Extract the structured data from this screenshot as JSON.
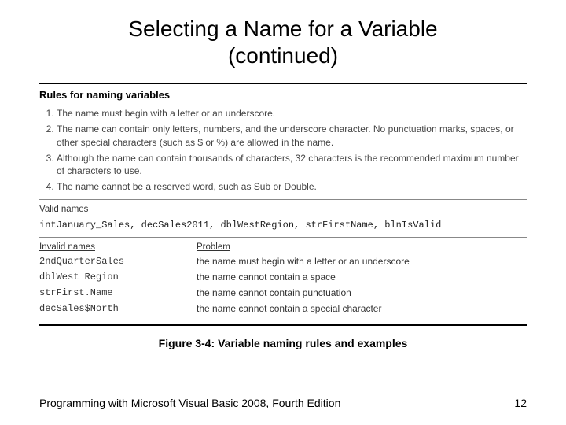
{
  "title_line1": "Selecting a Name for a Variable",
  "title_line2": "(continued)",
  "rules_heading": "Rules for naming variables",
  "rules": [
    "The name must begin with a letter or an underscore.",
    "The name can contain only letters, numbers, and the underscore character. No punctuation marks, spaces, or other special characters (such as $ or %) are allowed in the name.",
    "Although the name can contain thousands of characters, 32 characters is the recommended maximum number of characters to use.",
    "The name cannot be a reserved word, such as Sub or Double."
  ],
  "valid_heading": "Valid names",
  "valid_names": "intJanuary_Sales, decSales2011, dblWestRegion, strFirstName, blnIsValid",
  "invalid_heading_names": "Invalid names",
  "invalid_heading_problem": "Problem",
  "invalid": [
    {
      "name": "2ndQuarterSales",
      "problem": "the name must begin with a letter or an underscore"
    },
    {
      "name": "dblWest Region",
      "problem": "the name cannot contain a space"
    },
    {
      "name": "strFirst.Name",
      "problem": "the name cannot contain punctuation"
    },
    {
      "name": "decSales$North",
      "problem": "the name cannot contain a special character"
    }
  ],
  "caption": "Figure 3-4: Variable naming rules and examples",
  "footer_left": "Programming with Microsoft Visual Basic 2008, Fourth Edition",
  "footer_right": "12"
}
